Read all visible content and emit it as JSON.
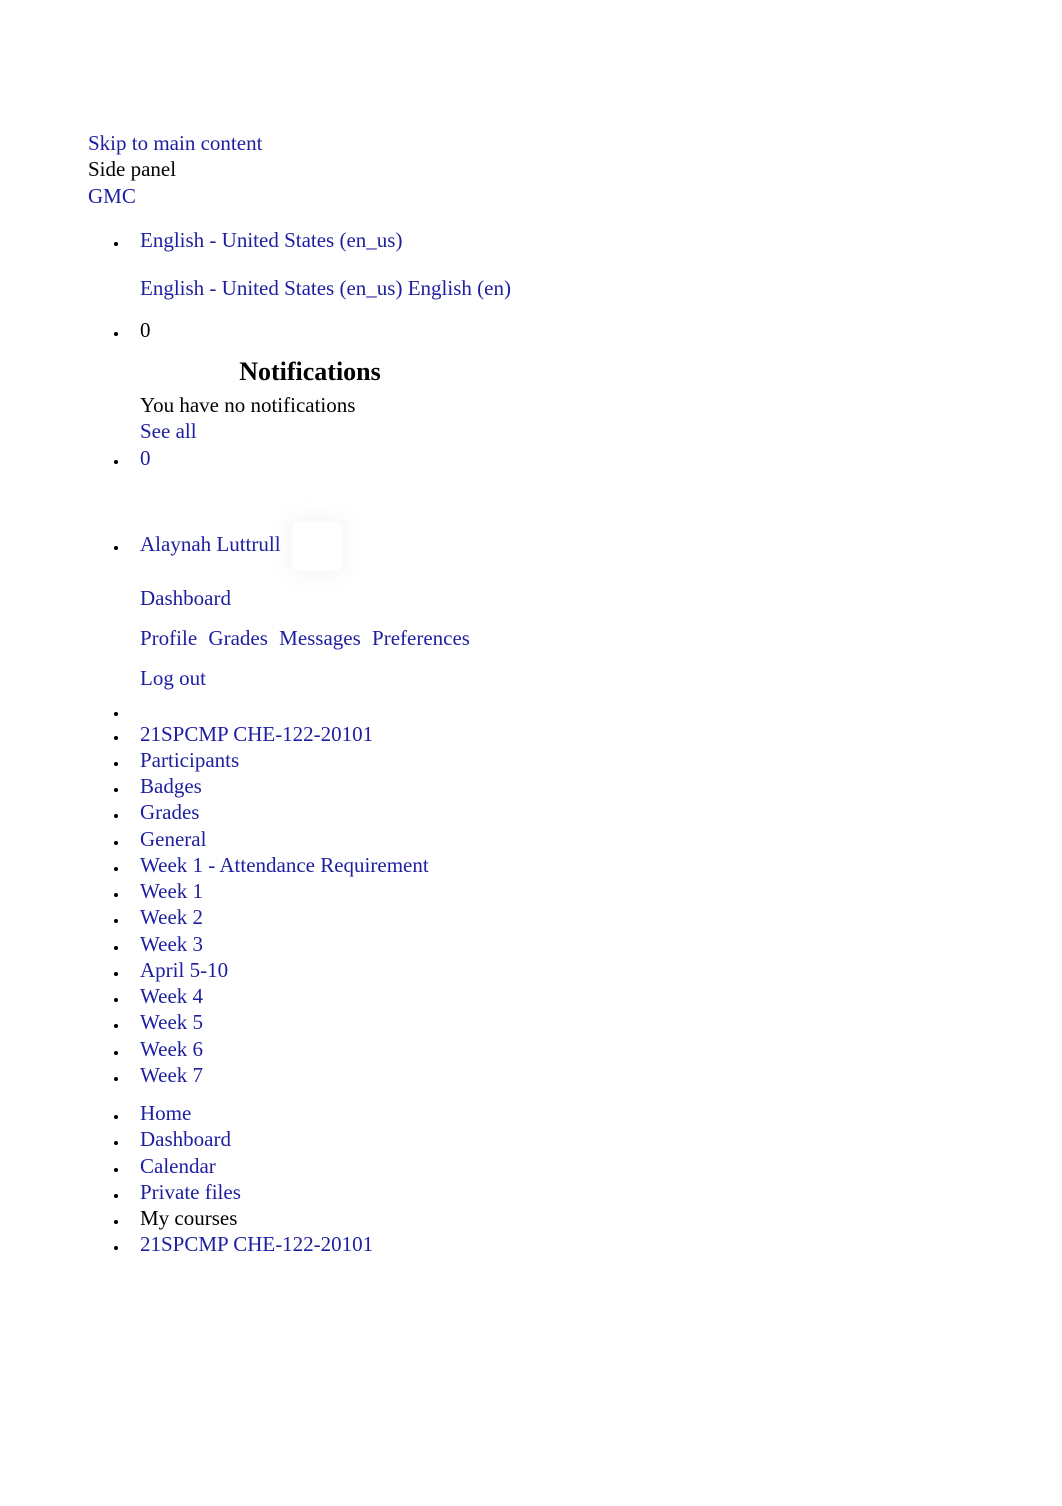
{
  "top": {
    "skip": "Skip to main content",
    "side_panel": "Side panel",
    "brand": "GMC"
  },
  "lang": {
    "current": "English - United States ‎(en_us)‎",
    "options": [
      "English - United States ‎(en_us)‎",
      "English ‎(en)‎"
    ]
  },
  "notifications": {
    "count": "0",
    "title": "Notifications",
    "empty": "You have no notifications",
    "see_all": "See all",
    "count2": "0"
  },
  "user": {
    "name": "Alaynah Luttrull",
    "dashboard": "Dashboard",
    "menu": [
      "Profile",
      "Grades",
      "Messages",
      "Preferences"
    ],
    "logout": "Log out"
  },
  "courseNav": [
    "21SPCMP CHE-122-20101",
    "Participants",
    "Badges",
    "Grades",
    "General",
    "Week 1 - Attendance Requirement",
    "Week 1",
    "Week 2",
    "Week 3",
    "April 5-10",
    "Week 4",
    "Week 5",
    "Week 6",
    "Week 7"
  ],
  "siteNav": {
    "home": "Home",
    "dashboard": "Dashboard",
    "calendar": "Calendar",
    "private_files": "Private files",
    "my_courses": "My courses",
    "course": "21SPCMP CHE-122-20101"
  }
}
